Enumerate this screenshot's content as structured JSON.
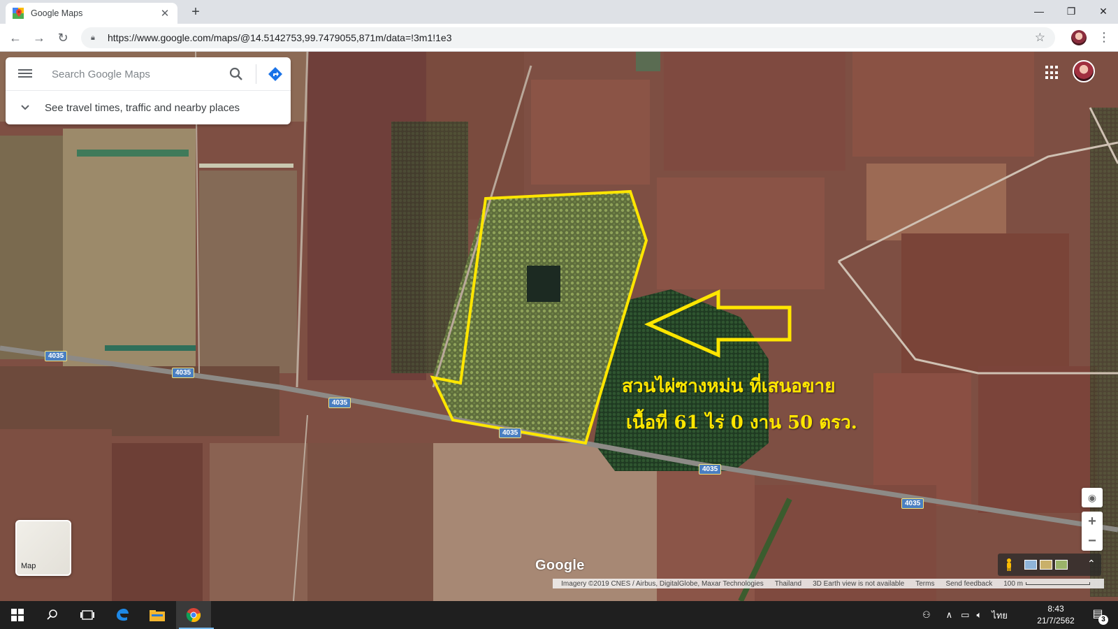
{
  "browser": {
    "tab_title": "Google Maps",
    "url": "https://www.google.com/maps/@14.5142753,99.7479055,871m/data=!3m1!1e3"
  },
  "maps": {
    "search_placeholder": "Search Google Maps",
    "travel_prompt": "See travel times, traffic and nearby places",
    "layer_label": "Map",
    "logo": "Google",
    "road_number": "4035",
    "footer": {
      "imagery": "Imagery ©2019 CNES / Airbus, DigitalGlobe, Maxar Technologies",
      "country": "Thailand",
      "earth_note": "3D Earth view is not available",
      "terms": "Terms",
      "feedback": "Send feedback",
      "scale": "100 m"
    }
  },
  "annotation": {
    "line1": "สวนไผ่ซางหม่น ที่เสนอขาย",
    "line2": "เนื้อที่ 61 ไร่ 0 งาน 50 ตรว.",
    "color": "#ffe600"
  },
  "taskbar": {
    "language": "ไทย",
    "time": "8:43",
    "date": "21/7/2562",
    "notification_count": "3"
  },
  "icons": [
    "hamburger-icon",
    "search-icon",
    "directions-icon",
    "chevron-down-icon",
    "apps-grid-icon",
    "my-location-icon",
    "zoom-in-icon",
    "zoom-out-icon",
    "pegman-icon",
    "windows-start-icon",
    "chrome-icon",
    "edge-icon",
    "file-explorer-icon"
  ]
}
